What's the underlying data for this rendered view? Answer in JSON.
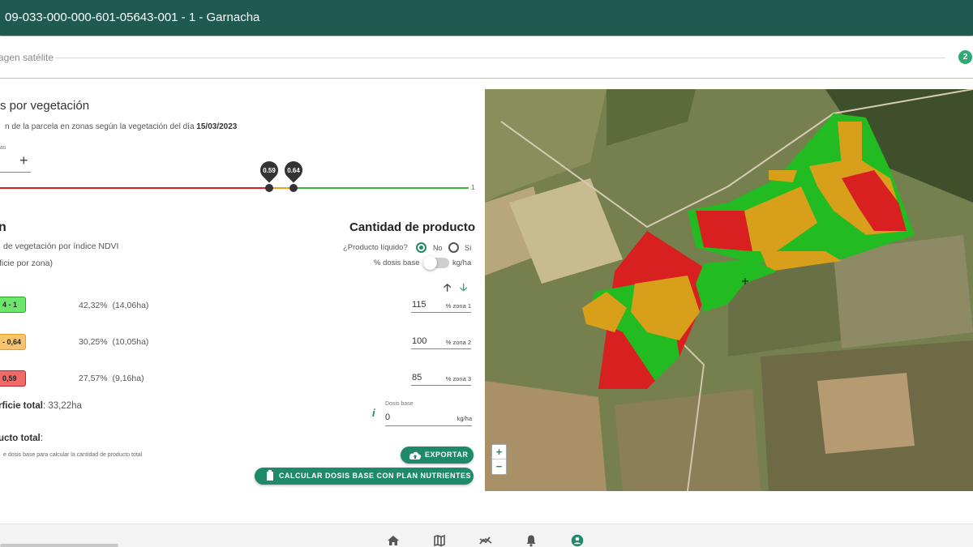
{
  "header": {
    "title": "09-033-000-000-601-05643-001 - 1 - Garnacha"
  },
  "stepper": {
    "step_label": "agen satélite",
    "step_number": "2"
  },
  "section": {
    "title": "s por vegetación",
    "description": "n de la parcela en zonas según la vegetación del día",
    "date": "15/03/2023"
  },
  "zones_count": {
    "label": "as",
    "value": ""
  },
  "slider": {
    "thresholds": [
      "0.59",
      "0.64"
    ],
    "max_label": "1",
    "colors": {
      "low": "#e02020",
      "mid": "#f0a020",
      "high": "#38b838"
    }
  },
  "zones": {
    "title": "n",
    "subtitle_1": "de vegetación por índice NDVI",
    "subtitle_2": "ficie por zona)",
    "rows": [
      {
        "range": "4 - 1",
        "pct": "42,32%",
        "ha": "(14,06ha)",
        "value": "115",
        "unit": "% zona 1",
        "color": "#6be66b"
      },
      {
        "range": "- 0,64",
        "pct": "30,25%",
        "ha": "(10,05ha)",
        "value": "100",
        "unit": "% zona 2",
        "color": "#f7c46b"
      },
      {
        "range": "0,59",
        "pct": "27,57%",
        "ha": "(9,16ha)",
        "value": "85",
        "unit": "% zona 3",
        "color": "#f06a6a"
      }
    ],
    "total_label": "rficie total",
    "total_value": ": 33,22ha"
  },
  "product": {
    "title": "Cantidad de producto",
    "liquid_label": "¿Producto líquido?",
    "option_no": "No",
    "option_si": "Sí",
    "selected": "No",
    "pct_label": "% dosis base",
    "kgha_label": "kg/ha",
    "dose_base_label": "Dosis base",
    "dose_base_value": "0",
    "dose_base_unit": "kg/ha",
    "total_label": "ucto total",
    "total_colon": ":",
    "hint": "e dosis base para calcular la cantidad de producto total"
  },
  "buttons": {
    "export": "EXPORTAR",
    "calc": "CALCULAR DOSIS BASE CON PLAN NUTRIENTES"
  },
  "map": {
    "zoom_in": "+",
    "zoom_out": "−",
    "zone_colors": {
      "green": "#22bb22",
      "orange": "#d8a01a",
      "red": "#d82020"
    }
  },
  "bottom_nav": [
    "home-icon",
    "map-icon",
    "chart-icon",
    "bell-icon",
    "user-icon"
  ]
}
